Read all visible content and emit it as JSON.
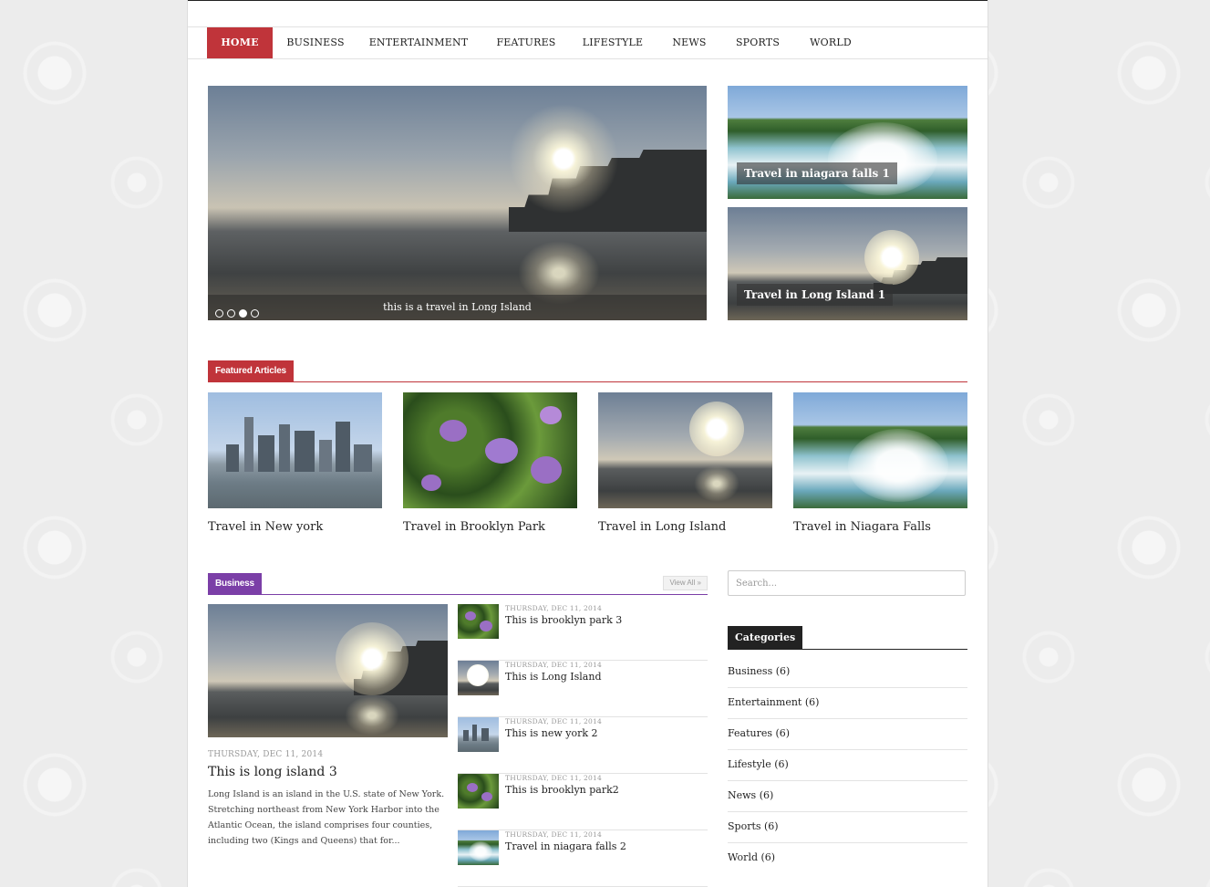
{
  "nav": {
    "items": [
      "HOME",
      "BUSINESS",
      "ENTERTAINMENT",
      "FEATURES",
      "LIFESTYLE",
      "NEWS",
      "SPORTS",
      "WORLD"
    ],
    "active": "HOME",
    "accent": "#c0343a"
  },
  "slider": {
    "caption": "this is a travel in Long Island",
    "dots": 4,
    "active_dot": 3
  },
  "side_slides": [
    {
      "caption": "Travel in niagara falls 1"
    },
    {
      "caption": "Travel in Long Island 1"
    }
  ],
  "featured": {
    "label": "Featured Articles",
    "articles": [
      {
        "title": "Travel in New york"
      },
      {
        "title": "Travel in Brooklyn Park"
      },
      {
        "title": "Travel in Long Island"
      },
      {
        "title": "Travel in Niagara Falls"
      }
    ]
  },
  "business": {
    "label": "Business",
    "view_all": "View All »",
    "accent": "#7b3fa7",
    "main": {
      "date": "THURSDAY, DEC 11, 2014",
      "title": "This is long island 3",
      "excerpt": "Long Island is an island in the U.S. state of New York. Stretching northeast from New York Harbor into the Atlantic Ocean, the island comprises four counties, including two (Kings and Queens) that for..."
    },
    "list": [
      {
        "date": "THURSDAY, DEC 11, 2014",
        "title": "This is brooklyn park 3"
      },
      {
        "date": "THURSDAY, DEC 11, 2014",
        "title": "This is Long Island"
      },
      {
        "date": "THURSDAY, DEC 11, 2014",
        "title": "This is new york 2"
      },
      {
        "date": "THURSDAY, DEC 11, 2014",
        "title": "This is brooklyn park2"
      },
      {
        "date": "THURSDAY, DEC 11, 2014",
        "title": "Travel in niagara falls 2"
      }
    ]
  },
  "sidebar": {
    "search_placeholder": "Search...",
    "categories_label": "Categories",
    "categories": [
      "Business (6)",
      "Entertainment (6)",
      "Features (6)",
      "Lifestyle (6)",
      "News (6)",
      "Sports (6)",
      "World (6)"
    ]
  }
}
